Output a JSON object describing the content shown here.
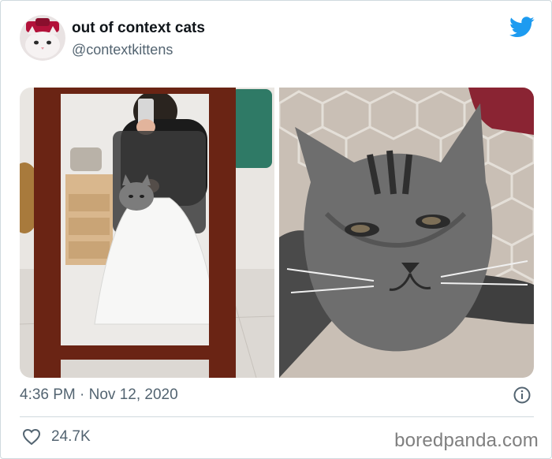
{
  "tweet": {
    "display_name": "out of context cats",
    "handle": "@contextkittens",
    "timestamp": "4:36 PM · Nov 12, 2020",
    "likes": "24.7K"
  },
  "icons": {
    "brand": "twitter-bird-icon",
    "info": "info-icon",
    "like": "heart-icon"
  },
  "colors": {
    "twitter_blue": "#1d9bf0",
    "text_primary": "#0f1419",
    "text_secondary": "#536471",
    "divider": "#cfd9de",
    "watermark": "#7f7f7f"
  },
  "watermark": "boredpanda.com"
}
